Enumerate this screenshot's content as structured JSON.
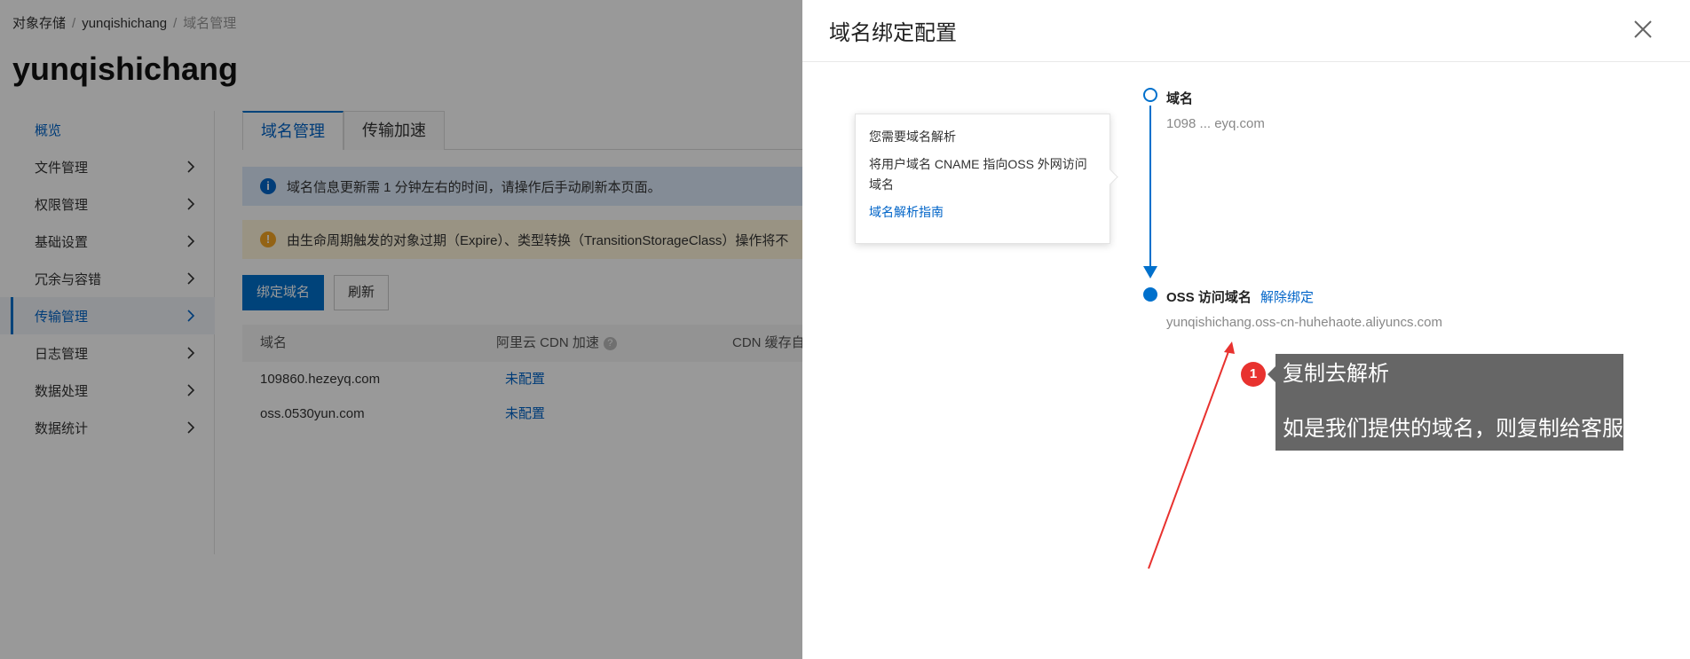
{
  "breadcrumb": {
    "items": [
      "对象存储",
      "yunqishichang",
      "域名管理"
    ]
  },
  "bucket_title": "yunqishichang",
  "sidebar": {
    "items": [
      {
        "label": "概览"
      },
      {
        "label": "文件管理"
      },
      {
        "label": "权限管理"
      },
      {
        "label": "基础设置"
      },
      {
        "label": "冗余与容错"
      },
      {
        "label": "传输管理"
      },
      {
        "label": "日志管理"
      },
      {
        "label": "数据处理"
      },
      {
        "label": "数据统计"
      }
    ]
  },
  "tabs": [
    {
      "label": "域名管理"
    },
    {
      "label": "传输加速"
    }
  ],
  "notices": {
    "info": "域名信息更新需 1 分钟左右的时间，请操作后手动刷新本页面。",
    "warn": "由生命周期触发的对象过期（Expire）、类型转换（TransitionStorageClass）操作将不"
  },
  "toolbar": {
    "bind_label": "绑定域名",
    "refresh_label": "刷新"
  },
  "table": {
    "headers": {
      "domain": "域名",
      "cdn": "阿里云 CDN 加速",
      "cdn_cache": "CDN 缓存自"
    },
    "rows": [
      {
        "domain": "109860.hezeyq.com",
        "cdn_status": "未配置"
      },
      {
        "domain": "oss.0530yun.com",
        "cdn_status": "未配置"
      }
    ]
  },
  "drawer": {
    "title": "域名绑定配置",
    "popover": {
      "title": "您需要域名解析",
      "desc": "将用户域名 CNAME 指向OSS 外网访问域名",
      "link": "域名解析指南"
    },
    "steps": {
      "domain_label": "域名",
      "domain_value": "1098 ... eyq.com",
      "oss_label": "OSS 访问域名",
      "oss_value": "yunqishichang.oss-cn-huhehaote.aliyuncs.com",
      "unbind_label": "解除绑定"
    }
  },
  "annotation": {
    "badge": "1",
    "title": "复制去解析",
    "body": "如是我们提供的域名，则复制给客服",
    "arrow_color": "#e8322f"
  },
  "colors": {
    "primary": "#0070cc",
    "link": "#0064c8",
    "callout_bg": "#666666",
    "badge": "#e8322f"
  }
}
